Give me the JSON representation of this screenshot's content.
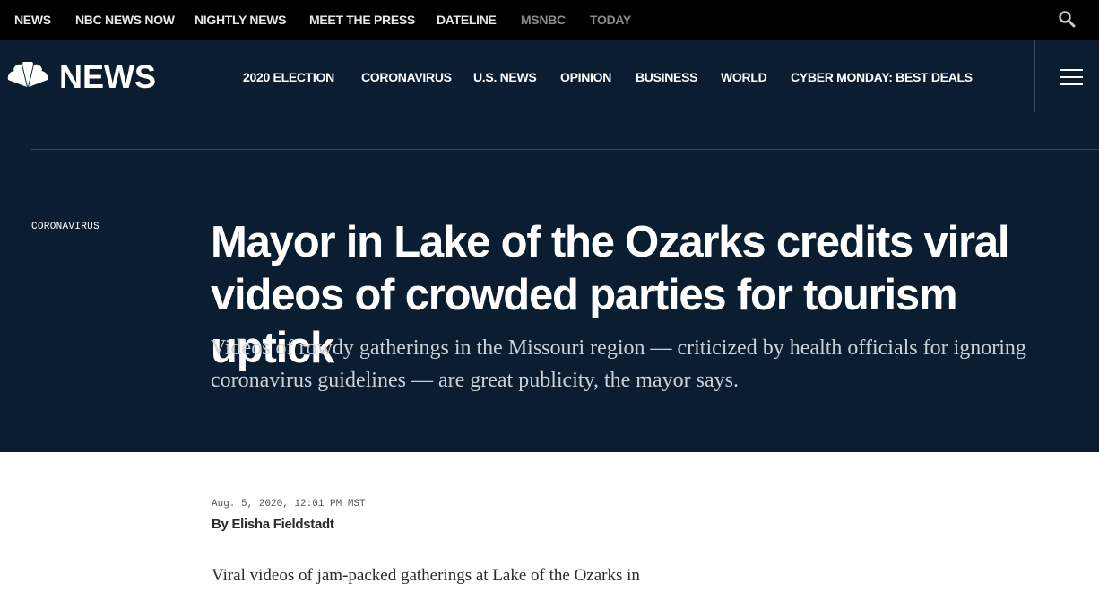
{
  "top_nav": {
    "items": [
      {
        "label": "NEWS"
      },
      {
        "label": "NBC NEWS NOW"
      },
      {
        "label": "NIGHTLY NEWS"
      },
      {
        "label": "MEET THE PRESS"
      },
      {
        "label": "DATELINE"
      },
      {
        "label": "MSNBC"
      },
      {
        "label": "TODAY"
      }
    ],
    "search_icon": "search-icon"
  },
  "brand": {
    "logo_icon": "peacock-icon",
    "wordmark": "NEWS"
  },
  "main_nav": {
    "items": [
      {
        "label": "2020 ELECTION"
      },
      {
        "label": "CORONAVIRUS"
      },
      {
        "label": "U.S. NEWS"
      },
      {
        "label": "OPINION"
      },
      {
        "label": "BUSINESS"
      },
      {
        "label": "WORLD"
      },
      {
        "label": "CYBER MONDAY: BEST DEALS"
      }
    ],
    "menu_icon": "hamburger-icon"
  },
  "article": {
    "section": "CORONAVIRUS",
    "headline": "Mayor in Lake of the Ozarks credits viral videos of crowded parties for tourism uptick",
    "dek": "Videos of rowdy gatherings in the Missouri region — criticized by health officials for ignoring coronavirus guidelines — are great publicity, the mayor says.",
    "date": "Aug. 5, 2020, 12:01 PM MST",
    "byline_prefix": "By",
    "author": "Elisha Fieldstadt",
    "body_first_line": "Viral videos of jam-packed gatherings at Lake of the Ozarks in"
  },
  "colors": {
    "top_bar": "#000000",
    "header_bg": "#0b1d31",
    "dim_link": "#8a8a8a",
    "dek_text": "#c9d1d9"
  }
}
